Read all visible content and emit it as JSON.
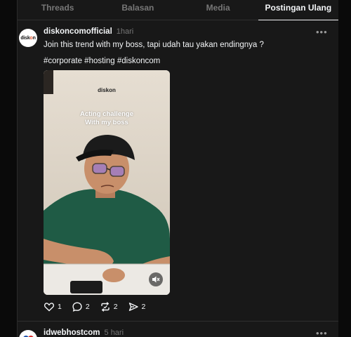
{
  "tabs": [
    {
      "label": "Threads",
      "active": false
    },
    {
      "label": "Balasan",
      "active": false
    },
    {
      "label": "Media",
      "active": false
    },
    {
      "label": "Postingan Ulang",
      "active": true
    }
  ],
  "post": {
    "username": "diskoncomofficial",
    "timestamp": "1hari",
    "caption": "Join this trend with my boss, tapi udah tau yakan endingnya ?",
    "hashtags": "#corporate #hosting #diskoncom",
    "video": {
      "brand": "diskon",
      "overlay_text": "Acting challenge\nWith my boss",
      "muted": true
    },
    "actions": {
      "likes": "1",
      "replies": "2",
      "reposts": "2",
      "shares": "2"
    }
  },
  "next_post": {
    "username": "idwebhostcom",
    "timestamp": "5 hari"
  },
  "colors": {
    "background": "#101010",
    "panel": "#181818",
    "text_primary": "#f3f5f7",
    "text_secondary": "#777777",
    "brand_accent": "#e4572e"
  }
}
